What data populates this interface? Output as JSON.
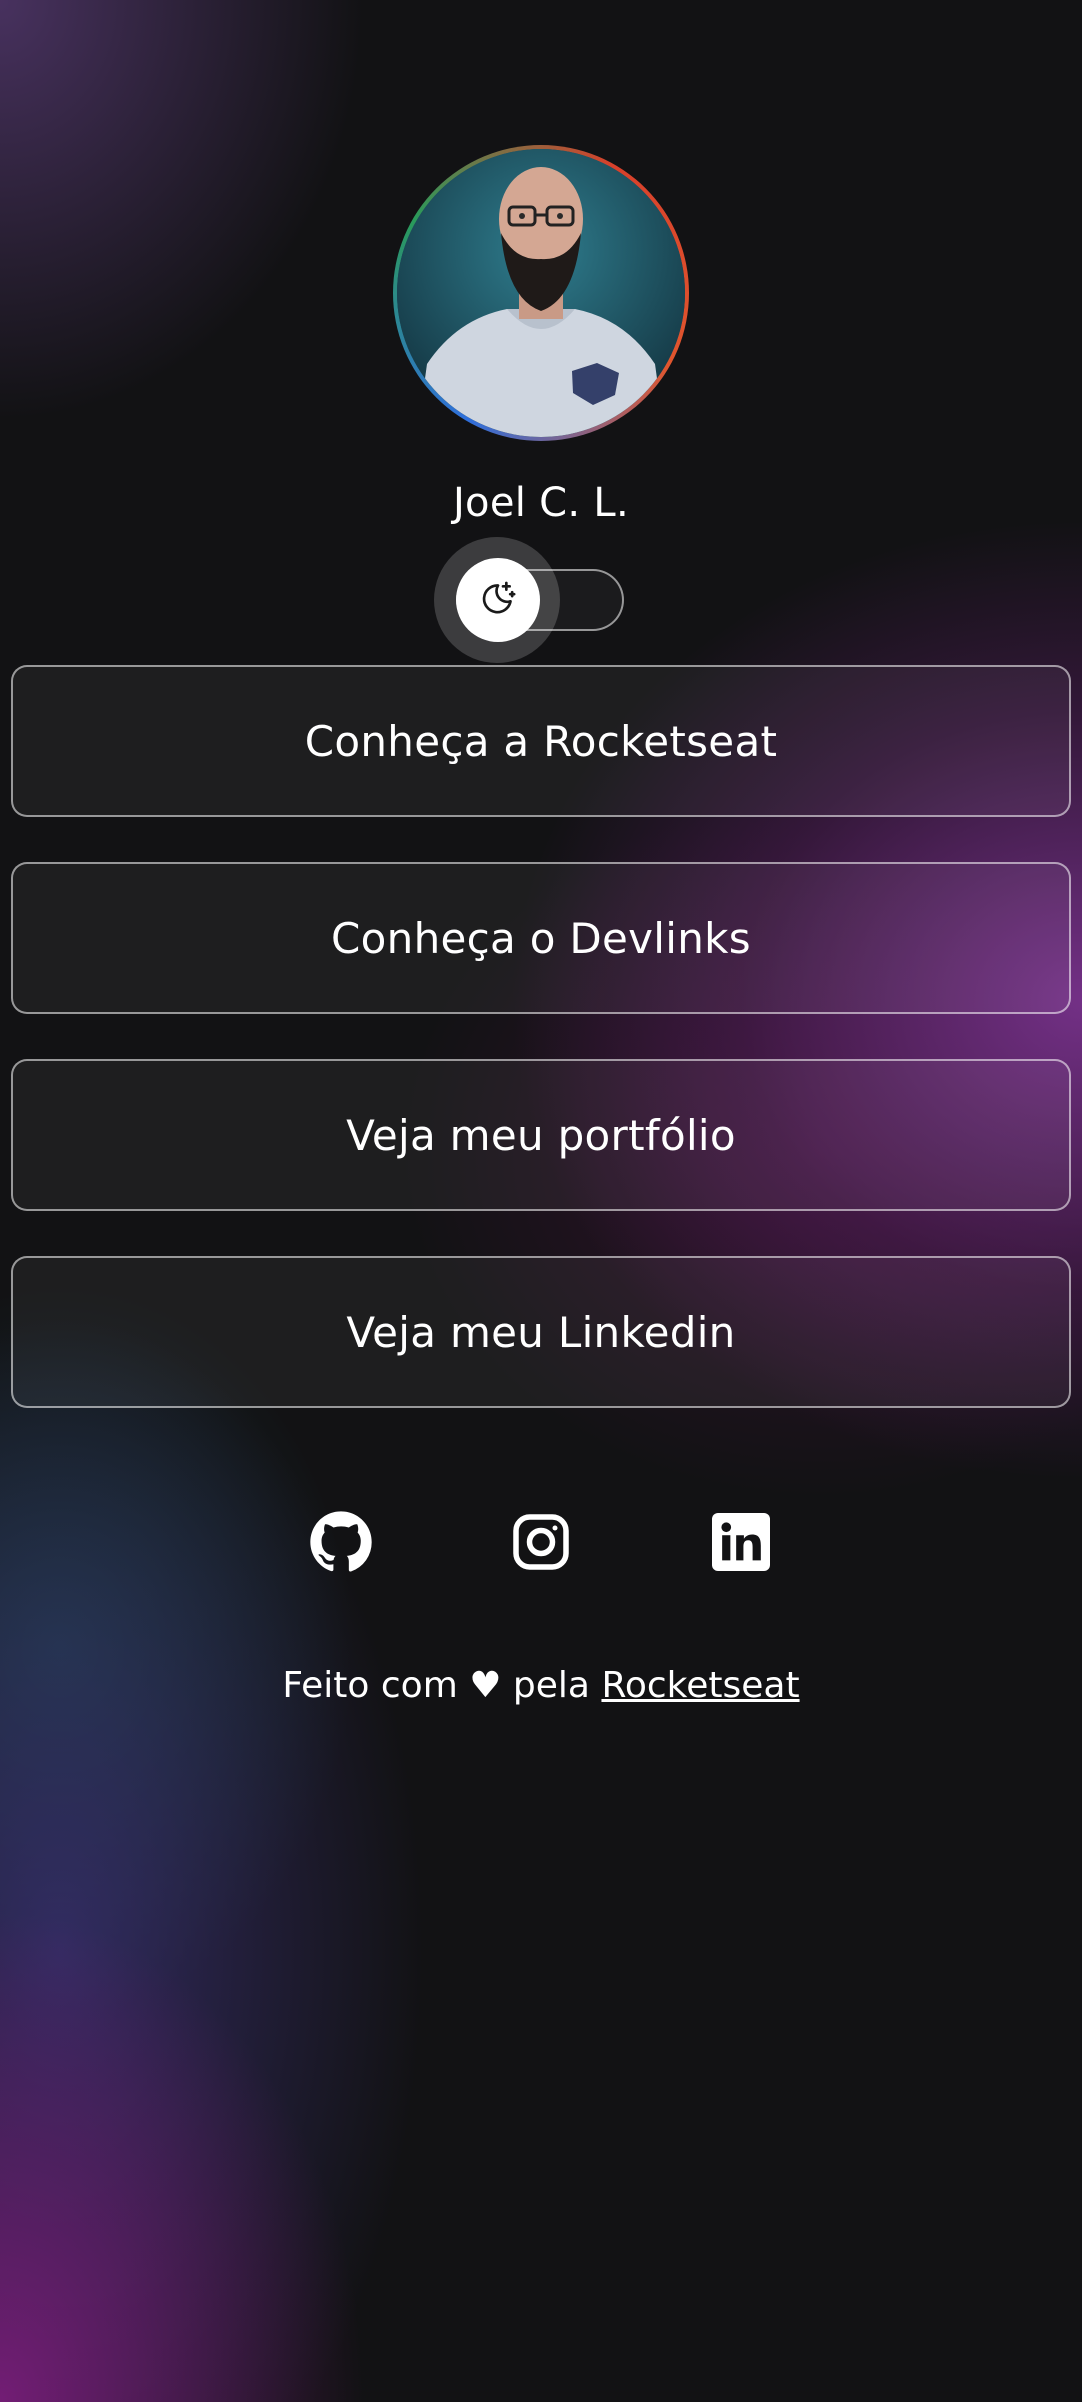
{
  "profile": {
    "name": "Joel C. L."
  },
  "theme_switch": {
    "icon": "moon-stars-icon"
  },
  "links": [
    {
      "label": "Conheça a Rocketseat"
    },
    {
      "label": "Conheça o Devlinks"
    },
    {
      "label": "Veja meu portfólio"
    },
    {
      "label": "Veja meu Linkedin"
    }
  ],
  "social": [
    {
      "icon": "github-icon"
    },
    {
      "icon": "instagram-icon"
    },
    {
      "icon": "linkedin-icon"
    }
  ],
  "footer": {
    "prefix": "Feito com ♥ pela",
    "link": "Rocketseat"
  },
  "colors": {
    "background": "#121214",
    "text": "#ffffff",
    "accent_purple": "#7a3290"
  }
}
